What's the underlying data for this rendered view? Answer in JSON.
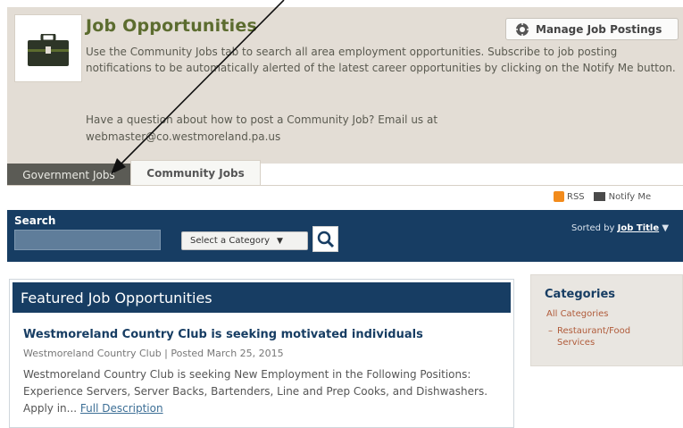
{
  "header": {
    "title": "Job Opportunities",
    "description": "Use the Community Jobs tab to search all area employment opportunities. Subscribe to job posting notifications to be automatically alerted of the latest career opportunities by clicking on the Notify Me button.",
    "question": "Have a question about how to post a Community Job? Email us at webmaster@co.westmoreland.pa.us",
    "manage_button": "Manage Job Postings",
    "icon": "briefcase-icon"
  },
  "tabs": [
    {
      "label": "Government Jobs",
      "active": false
    },
    {
      "label": "Community Jobs",
      "active": true
    }
  ],
  "tools": {
    "rss": "RSS",
    "notify": "Notify Me"
  },
  "search": {
    "label": "Search",
    "input_value": "",
    "category_select": "Select a Category",
    "sorted_by_label": "Sorted by",
    "sorted_by_value": "Job Title"
  },
  "featured": {
    "heading": "Featured Job Opportunities",
    "job": {
      "title": "Westmoreland Country Club is seeking motivated individuals",
      "meta": "Westmoreland Country Club | Posted March 25, 2015",
      "description": "Westmoreland Country Club is seeking New Employment in the Following Positions: Experience Servers, Server Backs, Bartenders, Line and Prep Cooks, and Dishwashers. Apply in...",
      "link": "Full Description"
    }
  },
  "categories": {
    "title": "Categories",
    "all": "All Categories",
    "items": [
      "Restaurant/Food Services"
    ]
  },
  "colors": {
    "navy": "#173d63",
    "header_bg": "#e3ddd5",
    "title_green": "#5c6c2f",
    "accent_link": "#b05b3a"
  }
}
